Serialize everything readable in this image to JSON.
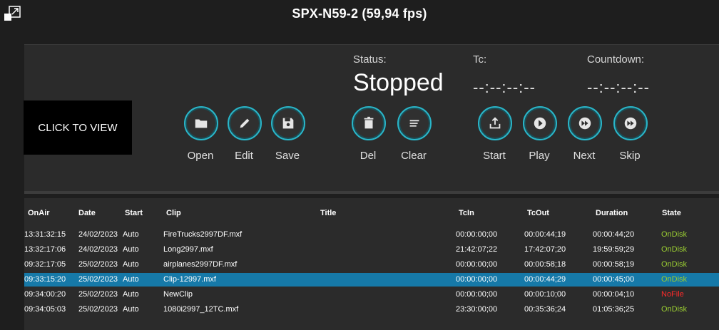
{
  "window": {
    "title": "SPX-N59-2 (59,94 fps)"
  },
  "preview": {
    "label": "CLICK TO VIEW"
  },
  "status": {
    "label": "Status:",
    "value": "Stopped"
  },
  "tc": {
    "label": "Tc:",
    "value": "--:--:--:--"
  },
  "countdown": {
    "label": "Countdown:",
    "value": "--:--:--:--"
  },
  "buttons": {
    "open": "Open",
    "edit": "Edit",
    "save": "Save",
    "del": "Del",
    "clear": "Clear",
    "start": "Start",
    "play": "Play",
    "next": "Next",
    "skip": "Skip"
  },
  "colors": {
    "accent": "#29b6c9",
    "selected_row": "#1679a8",
    "ondisk": "#9acd32",
    "nofile": "#ff2a2a"
  },
  "table": {
    "headers": {
      "onair": "OnAir",
      "date": "Date",
      "start": "Start",
      "clip": "Clip",
      "title": "Title",
      "tcin": "TcIn",
      "tcout": "TcOut",
      "duration": "Duration",
      "state": "State"
    },
    "rows": [
      {
        "onair": "13:31:32:15",
        "date": "24/02/2023",
        "start": "Auto",
        "clip": "FireTrucks2997DF.mxf",
        "title": "",
        "tcin": "00:00:00;00",
        "tcout": "00:00:44;19",
        "duration": "00:00:44;20",
        "state": "OnDisk"
      },
      {
        "onair": "13:32:17:06",
        "date": "24/02/2023",
        "start": "Auto",
        "clip": "Long2997.mxf",
        "title": "",
        "tcin": "21:42:07;22",
        "tcout": "17:42:07;20",
        "duration": "19:59:59;29",
        "state": "OnDisk"
      },
      {
        "onair": "09:32:17:05",
        "date": "25/02/2023",
        "start": "Auto",
        "clip": "airplanes2997DF.mxf",
        "title": "",
        "tcin": "00:00:00;00",
        "tcout": "00:00:58;18",
        "duration": "00:00:58;19",
        "state": "OnDisk"
      },
      {
        "onair": "09:33:15:20",
        "date": "25/02/2023",
        "start": "Auto",
        "clip": "Clip-12997.mxf",
        "title": "",
        "tcin": "00:00:00;00",
        "tcout": "00:00:44;29",
        "duration": "00:00:45;00",
        "state": "OnDisk"
      },
      {
        "onair": "09:34:00:20",
        "date": "25/02/2023",
        "start": "Auto",
        "clip": "NewClip",
        "title": "",
        "tcin": "00:00:00;00",
        "tcout": "00:00:10;00",
        "duration": "00:00:04;10",
        "state": "NoFile"
      },
      {
        "onair": "09:34:05:03",
        "date": "25/02/2023",
        "start": "Auto",
        "clip": "1080i2997_12TC.mxf",
        "title": "",
        "tcin": "23:30:00;00",
        "tcout": "00:35:36;24",
        "duration": "01:05:36;25",
        "state": "OnDisk"
      }
    ]
  }
}
